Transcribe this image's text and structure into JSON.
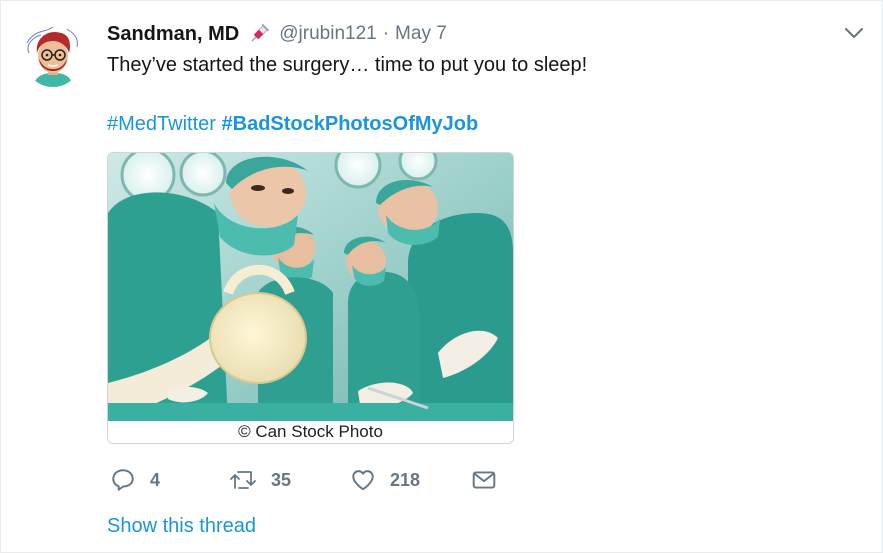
{
  "tweet": {
    "display_name": "Sandman, MD",
    "name_emoji": "syringe-emoji",
    "handle": "@jrubin121",
    "separator": "·",
    "date": "May 7",
    "text": "They’ve started the surgery… time to put you to sleep!",
    "hashtags": [
      "#MedTwitter",
      "#BadStockPhotosOfMyJob"
    ],
    "media": {
      "watermark": "© Can Stock Photo"
    },
    "actions": {
      "reply_count": "4",
      "retweet_count": "35",
      "like_count": "218"
    },
    "show_thread": "Show this thread"
  },
  "colors": {
    "link": "#1b95e0",
    "muted": "#657786",
    "text": "#14171a",
    "scrub_teal": "#2fa598"
  },
  "icons": [
    "caret-down-icon",
    "reply-icon",
    "retweet-icon",
    "like-icon",
    "direct-message-icon"
  ]
}
